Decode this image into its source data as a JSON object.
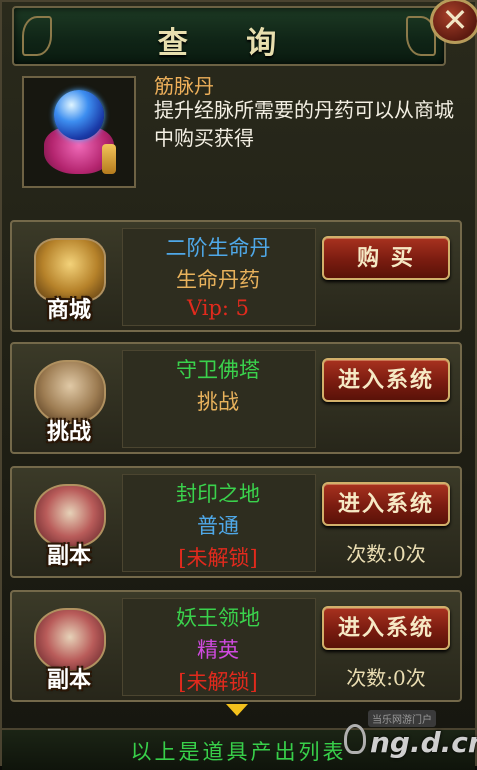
{
  "header": {
    "title": "查 询",
    "close_label": "✕"
  },
  "item": {
    "name": "筋脉丹",
    "description": "提升经脉所需要的丹药可以从商城中购买获得"
  },
  "sources": [
    {
      "icon_name": "shop-chest-icon",
      "icon_label": "商城",
      "line1": "二阶生命丹",
      "line1_color": "#4fa8e8",
      "line2": "生命丹药",
      "line2_color": "#e8b25c",
      "line3": "Vip: 5",
      "line3_color": "#e12a1d",
      "button_label": "购 买",
      "count": ""
    },
    {
      "icon_name": "horned-skull-icon",
      "icon_label": "挑战",
      "line1": "守卫佛塔",
      "line1_color": "#3ad24c",
      "line2": "挑战",
      "line2_color": "#e8b25c",
      "line3": "",
      "line3_color": "#e12a1d",
      "button_label": "进入系统",
      "count": ""
    },
    {
      "icon_name": "winged-skull-icon",
      "icon_label": "副本",
      "line1": "封印之地",
      "line1_color": "#3ad24c",
      "line2": "普通",
      "line2_color": "#4fa8e8",
      "line3": "[未解锁]",
      "line3_color": "#e12a1d",
      "button_label": "进入系统",
      "count": "次数:0次"
    },
    {
      "icon_name": "winged-skull-icon",
      "icon_label": "副本",
      "line1": "妖王领地",
      "line1_color": "#3ad24c",
      "line2": "精英",
      "line2_color": "#d04ae0",
      "line3": "[未解锁]",
      "line3_color": "#e12a1d",
      "button_label": "进入系统",
      "count": "次数:0次"
    }
  ],
  "footer": {
    "text": "以上是道具产出列表"
  },
  "watermark": {
    "top": "当乐网游门户",
    "main": "ng.d.cn"
  }
}
